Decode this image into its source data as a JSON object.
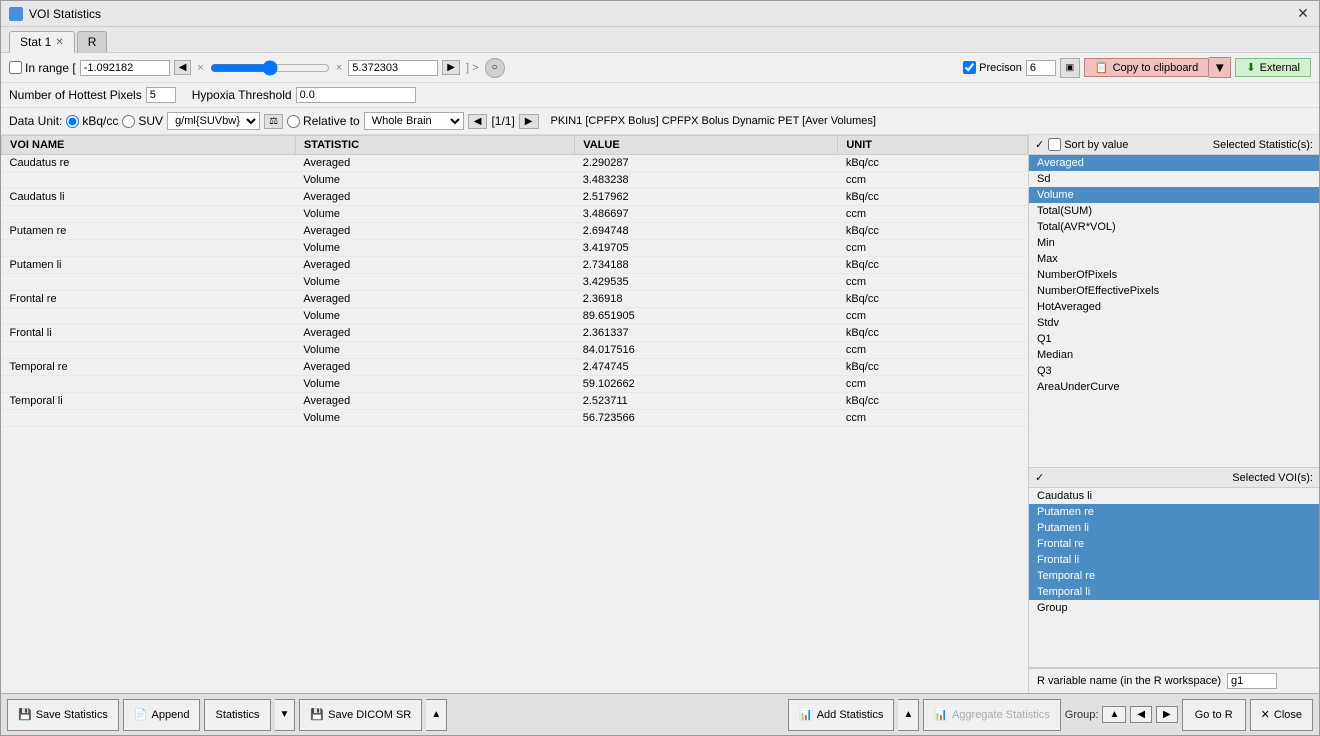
{
  "window": {
    "title": "VOI Statistics"
  },
  "tabs": [
    {
      "id": "stat1",
      "label": "Stat 1",
      "active": true,
      "closeable": true
    },
    {
      "id": "r",
      "label": "R",
      "active": false,
      "closeable": false
    }
  ],
  "toolbar": {
    "in_range_label": "In range [",
    "range_min": "-1.092182",
    "range_max": "5.372303",
    "precision_label": "Precison",
    "precision_value": "6",
    "copy_clipboard_label": "Copy to clipboard",
    "external_label": "External"
  },
  "data_unit": {
    "label": "Data Unit:",
    "kbq_label": "kBq/cc",
    "suv_label": "SUV",
    "unit_value": "g/ml{SUVbw}",
    "relative_label": "Relative to",
    "whole_brain_label": "Whole Brain",
    "page_indicator": "[1/1]",
    "dataset_label": "PKIN1 [CPFPX Bolus] CPFPX Bolus Dynamic PET [Aver Volumes]"
  },
  "table": {
    "headers": [
      "VOI NAME",
      "STATISTIC",
      "VALUE",
      "UNIT"
    ],
    "rows": [
      {
        "name": "Caudatus re",
        "stat": "Averaged",
        "value": "2.290287",
        "unit": "kBq/cc"
      },
      {
        "name": "",
        "stat": "Volume",
        "value": "3.483238",
        "unit": "ccm"
      },
      {
        "name": "Caudatus li",
        "stat": "Averaged",
        "value": "2.517962",
        "unit": "kBq/cc"
      },
      {
        "name": "",
        "stat": "Volume",
        "value": "3.486697",
        "unit": "ccm"
      },
      {
        "name": "Putamen re",
        "stat": "Averaged",
        "value": "2.694748",
        "unit": "kBq/cc"
      },
      {
        "name": "",
        "stat": "Volume",
        "value": "3.419705",
        "unit": "ccm"
      },
      {
        "name": "Putamen li",
        "stat": "Averaged",
        "value": "2.734188",
        "unit": "kBq/cc"
      },
      {
        "name": "",
        "stat": "Volume",
        "value": "3.429535",
        "unit": "ccm"
      },
      {
        "name": "Frontal re",
        "stat": "Averaged",
        "value": "2.36918",
        "unit": "kBq/cc"
      },
      {
        "name": "",
        "stat": "Volume",
        "value": "89.651905",
        "unit": "ccm"
      },
      {
        "name": "Frontal li",
        "stat": "Averaged",
        "value": "2.361337",
        "unit": "kBq/cc"
      },
      {
        "name": "",
        "stat": "Volume",
        "value": "84.017516",
        "unit": "ccm"
      },
      {
        "name": "Temporal re",
        "stat": "Averaged",
        "value": "2.474745",
        "unit": "kBq/cc"
      },
      {
        "name": "",
        "stat": "Volume",
        "value": "59.102662",
        "unit": "ccm"
      },
      {
        "name": "Temporal li",
        "stat": "Averaged",
        "value": "2.523711",
        "unit": "kBq/cc"
      },
      {
        "name": "",
        "stat": "Volume",
        "value": "56.723566",
        "unit": "ccm"
      }
    ]
  },
  "statistics_panel": {
    "header_check": "✓",
    "sort_by_value": "Sort by value",
    "selected_label": "Selected Statistic(s):",
    "items": [
      {
        "id": "averaged",
        "label": "Averaged",
        "selected": true
      },
      {
        "id": "sd",
        "label": "Sd",
        "selected": false
      },
      {
        "id": "volume",
        "label": "Volume",
        "selected": true
      },
      {
        "id": "total_sum",
        "label": "Total(SUM)",
        "selected": false
      },
      {
        "id": "total_avr",
        "label": "Total(AVR*VOL)",
        "selected": false
      },
      {
        "id": "min",
        "label": "Min",
        "selected": false
      },
      {
        "id": "max",
        "label": "Max",
        "selected": false
      },
      {
        "id": "number_of_pixels",
        "label": "NumberOfPixels",
        "selected": false
      },
      {
        "id": "number_effective",
        "label": "NumberOfEffectivePixels",
        "selected": false
      },
      {
        "id": "hot_averaged",
        "label": "HotAveraged",
        "selected": false
      },
      {
        "id": "stdv",
        "label": "Stdv",
        "selected": false
      },
      {
        "id": "q1",
        "label": "Q1",
        "selected": false
      },
      {
        "id": "median",
        "label": "Median",
        "selected": false
      },
      {
        "id": "q3",
        "label": "Q3",
        "selected": false
      },
      {
        "id": "area_under_curve",
        "label": "AreaUnderCurve",
        "selected": false
      }
    ]
  },
  "voi_panel": {
    "header_check": "✓",
    "selected_label": "Selected VOI(s):",
    "items": [
      {
        "id": "caudatus_li",
        "label": "Caudatus li",
        "selected": false
      },
      {
        "id": "putamen_re",
        "label": "Putamen re",
        "selected": true
      },
      {
        "id": "putamen_li",
        "label": "Putamen li",
        "selected": true
      },
      {
        "id": "frontal_re",
        "label": "Frontal re",
        "selected": true
      },
      {
        "id": "frontal_li",
        "label": "Frontal li",
        "selected": true
      },
      {
        "id": "temporal_re",
        "label": "Temporal re",
        "selected": true
      },
      {
        "id": "temporal_li",
        "label": "Temporal li",
        "selected": true
      },
      {
        "id": "group",
        "label": "Group",
        "selected": false
      }
    ]
  },
  "r_variable": {
    "label": "R variable name (in the R workspace)",
    "value": "g1"
  },
  "bottom_bar": {
    "save_statistics": "Save Statistics",
    "append": "Append",
    "statistics": "Statistics",
    "save_dicom": "Save DICOM SR",
    "add_statistics": "Add Statistics",
    "aggregate_statistics": "Aggregate Statistics",
    "group_label": "Group:",
    "go_to_r": "Go to R",
    "close": "Close"
  },
  "hottest_pixels": {
    "label": "Number of Hottest Pixels",
    "value": "5"
  },
  "hypoxia": {
    "label": "Hypoxia Threshold",
    "value": "0.0"
  }
}
